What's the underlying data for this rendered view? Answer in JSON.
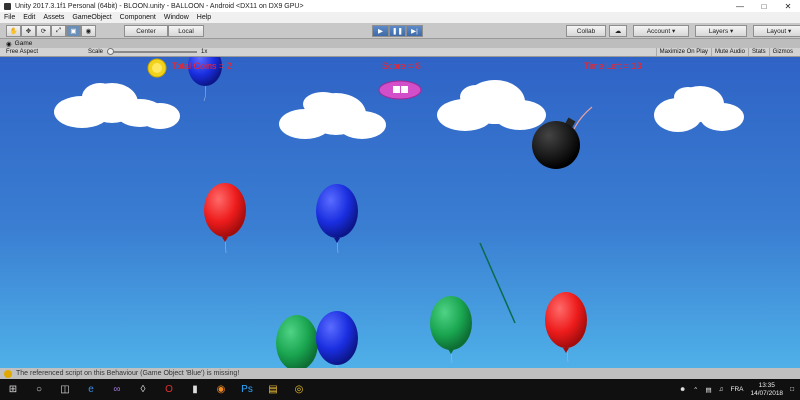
{
  "window": {
    "title": "Unity 2017.3.1f1 Personal (64bit) - BLOON.unity - BALLOON - Android <DX11 on DX9 GPU>"
  },
  "menu": [
    "File",
    "Edit",
    "Assets",
    "GameObject",
    "Component",
    "Window",
    "Help"
  ],
  "toolbar": {
    "pivot": "Center",
    "space": "Local",
    "collab": "Collab",
    "account": "Account",
    "layers": "Layers",
    "layout": "Layout"
  },
  "game_tab": {
    "label": "Game"
  },
  "game_toolbar": {
    "aspect": "Free Aspect",
    "scale_label": "Scale",
    "scale_value": "1x",
    "maximize": "Maximize On Play",
    "mute": "Mute Audio",
    "stats": "Stats",
    "gizmos": "Gizmos"
  },
  "hud": {
    "coins": "Total Coins = 2",
    "score": "Score = 8",
    "time": "Time Left = 13"
  },
  "status": {
    "message": "The referenced script on this Behaviour (Game Object 'Blue') is missing!"
  },
  "taskbar": {
    "lang": "FRA",
    "time": "13:35",
    "date": "14/07/2018"
  },
  "colors": {
    "balloon_red": "#ee1c1c",
    "balloon_blue": "#1a2ee0",
    "balloon_green": "#1aa550",
    "hud_text": "#ff2020"
  }
}
